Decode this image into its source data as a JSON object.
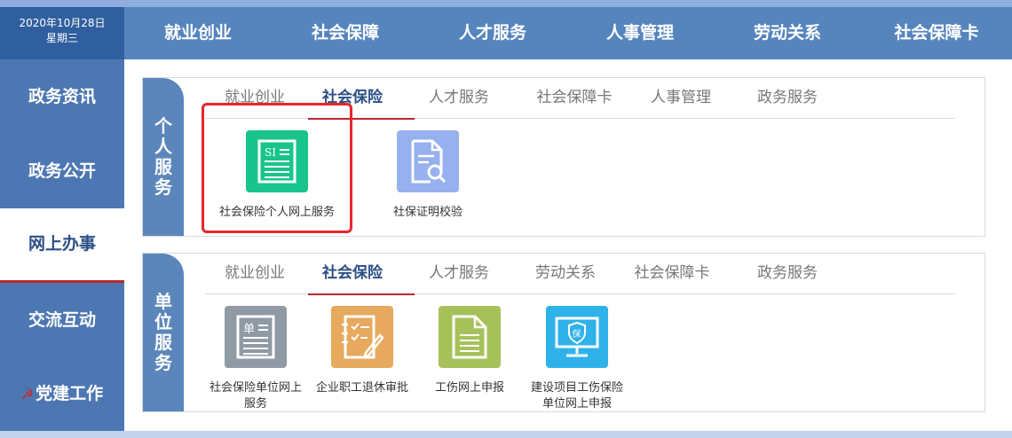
{
  "header": {
    "date": "2020年10月28日",
    "weekday": "星期三",
    "nav": [
      "就业创业",
      "社会保障",
      "人才服务",
      "人事管理",
      "劳动关系",
      "社会保障卡"
    ]
  },
  "sidebar": {
    "items": [
      {
        "label": "政务资讯"
      },
      {
        "label": "政务公开"
      },
      {
        "label": "网上办事"
      },
      {
        "label": "交流互动"
      },
      {
        "label": "党建工作",
        "icon": "party-emblem-icon"
      }
    ],
    "active": "网上办事"
  },
  "personal": {
    "label_chars": [
      "个",
      "人",
      "服",
      "务"
    ],
    "tabs": [
      "就业创业",
      "社会保险",
      "人才服务",
      "社会保障卡",
      "人事管理",
      "政务服务"
    ],
    "active_tab": "社会保险",
    "services": [
      {
        "label": "社会保险个人网上服务",
        "icon": "si-document-icon",
        "color": "#19c48c"
      },
      {
        "label": "社保证明校验",
        "icon": "document-search-icon",
        "color": "#97b1ee"
      }
    ]
  },
  "unit": {
    "label_chars": [
      "单",
      "位",
      "服",
      "务"
    ],
    "tabs": [
      "就业创业",
      "社会保险",
      "人才服务",
      "劳动关系",
      "社会保障卡",
      "政务服务"
    ],
    "active_tab": "社会保险",
    "services": [
      {
        "label_lines": [
          "社会保险单位网上",
          "服务"
        ],
        "icon": "unit-document-icon",
        "color": "#8f9aa5"
      },
      {
        "label_lines": [
          "企业职工退休审批"
        ],
        "icon": "checklist-pen-icon",
        "color": "#e6a95d"
      },
      {
        "label_lines": [
          "工伤网上申报"
        ],
        "icon": "document-icon",
        "color": "#a7c15a"
      },
      {
        "label_lines": [
          "建设项目工伤保险",
          "单位网上申报"
        ],
        "icon": "monitor-shield-icon",
        "color": "#2fb2ea"
      }
    ]
  },
  "colors": {
    "header_nav": "#5685be",
    "date_box": "#2f5f9e",
    "sidebar": "#4d77b2",
    "accent_red": "#b7282e",
    "highlight": "#e8262b"
  }
}
